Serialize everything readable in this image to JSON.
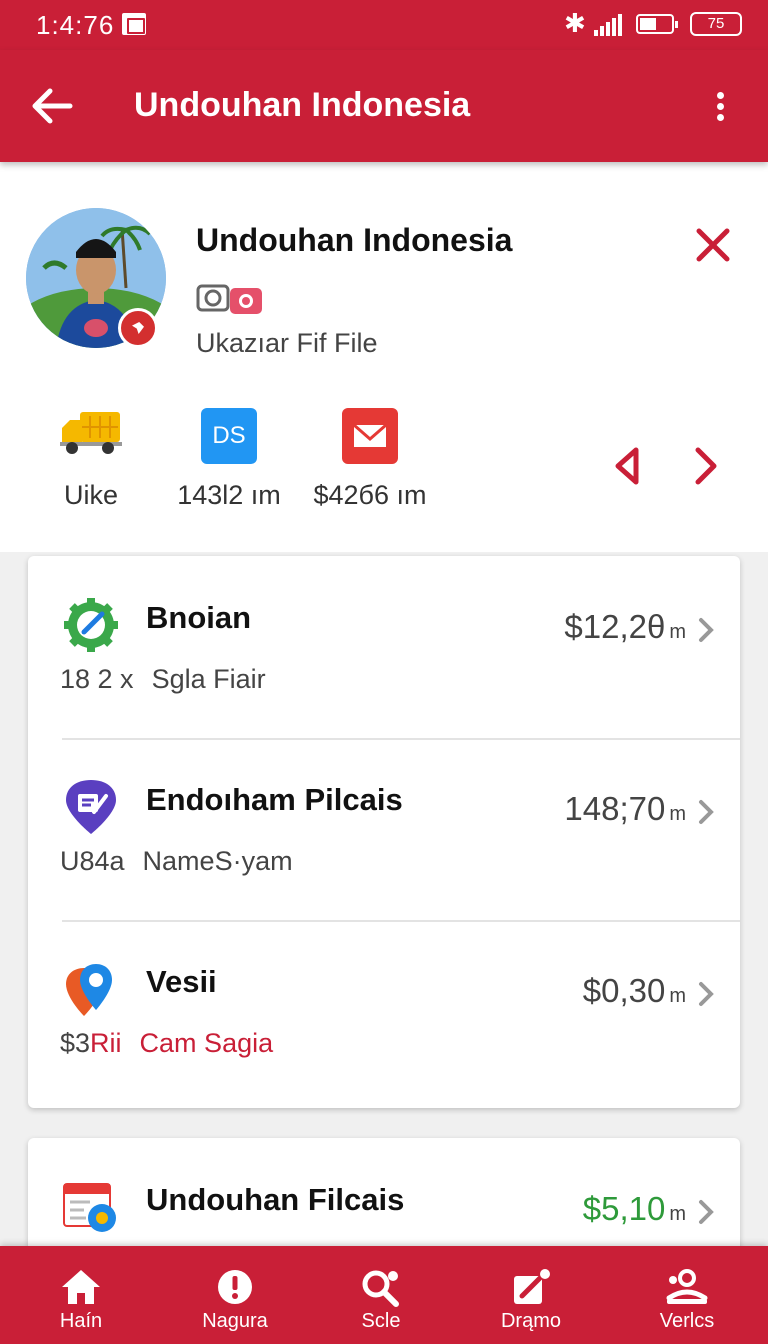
{
  "status_bar": {
    "time": "1:4:76",
    "battery_label": "75"
  },
  "app_bar": {
    "title": "Undouhan Indonesia"
  },
  "profile": {
    "name": "Undouhan Indonesia",
    "subtitle": "Ukazıar Fif File"
  },
  "quick_actions": [
    {
      "label": "Uike",
      "icon": "truck-icon"
    },
    {
      "label": "143l2 ım",
      "icon": "ds-icon",
      "icon_text": "DS"
    },
    {
      "label": "$42б6 ım",
      "icon": "mail-icon"
    }
  ],
  "transactions": [
    {
      "title": "Bnoian",
      "amount": "$12,2θ",
      "unit": "m",
      "meta": "18 2 x",
      "meta_sub": "Sgla Fiair",
      "icon": "gear-edit-icon"
    },
    {
      "title": "Endoıham Pilcais",
      "amount": "148;70",
      "unit": "m",
      "meta": "U84a",
      "meta_sub": "NameS·yam",
      "icon": "pin-edit-icon"
    },
    {
      "title": "Vesii",
      "amount": "$0,30",
      "unit": "m",
      "meta": "$3",
      "meta_em": "Rii",
      "meta_sub": "Cam Sagia",
      "icon": "map-pin-icon"
    },
    {
      "title": "Undouhan Filcais",
      "amount": "$5,10",
      "unit": "m",
      "icon": "calendar-gear-icon",
      "amount_color": "#2e9a3a"
    }
  ],
  "bottom_nav": [
    {
      "label": "Haín",
      "icon": "home-icon"
    },
    {
      "label": "Nagura",
      "icon": "alert-icon"
    },
    {
      "label": "Scle",
      "icon": "search-icon"
    },
    {
      "label": "Drąmo",
      "icon": "edit-icon"
    },
    {
      "label": "Verlcs",
      "icon": "profile-icon"
    }
  ],
  "colors": {
    "brand": "#c91f37",
    "green_amount": "#2e9a3a",
    "ds_blue": "#2196f3"
  }
}
